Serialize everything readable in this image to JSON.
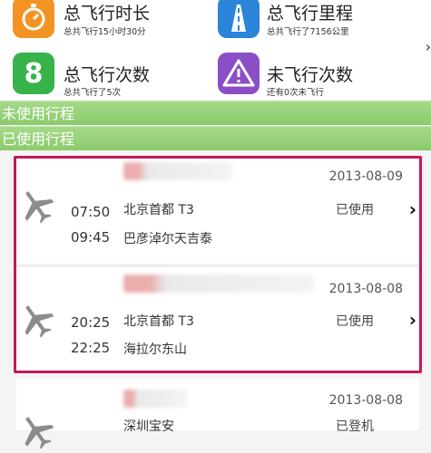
{
  "stats": [
    {
      "id": "total-time",
      "title": "总飞行时长",
      "subtitle": "总共飞行15小时30分",
      "icon": "stopwatch-icon",
      "color": "#f39323"
    },
    {
      "id": "total-distance",
      "title": "总飞行里程",
      "subtitle": "总共飞行了7156公里",
      "icon": "road-icon",
      "color": "#2a84d8"
    },
    {
      "id": "total-flights",
      "title": "总飞行次数",
      "subtitle": "总共飞行了5次",
      "icon": "number-8-icon",
      "icon_text": "8",
      "color": "#37b34a"
    },
    {
      "id": "unflown",
      "title": "未飞行次数",
      "subtitle": "还有0次未飞行",
      "icon": "warning-icon",
      "color": "#8a4fc6"
    }
  ],
  "sections": {
    "unused": "未使用行程",
    "used": "已使用行程"
  },
  "trips": [
    {
      "date": "2013-08-09",
      "dep_time": "07:50",
      "arr_time": "09:45",
      "from": "北京首都 T3",
      "to": "巴彦淖尔天吉泰",
      "status": "已使用"
    },
    {
      "date": "2013-08-08",
      "dep_time": "20:25",
      "arr_time": "22:25",
      "from": "北京首都 T3",
      "to": "海拉尔东山",
      "status": "已使用"
    },
    {
      "date": "2013-08-08",
      "dep_time": "",
      "arr_time": "",
      "from": "深圳宝安",
      "to": "",
      "status": "已登机"
    }
  ],
  "colors": {
    "section_bar": "#8ccb6c",
    "highlight": "#c2185b"
  }
}
